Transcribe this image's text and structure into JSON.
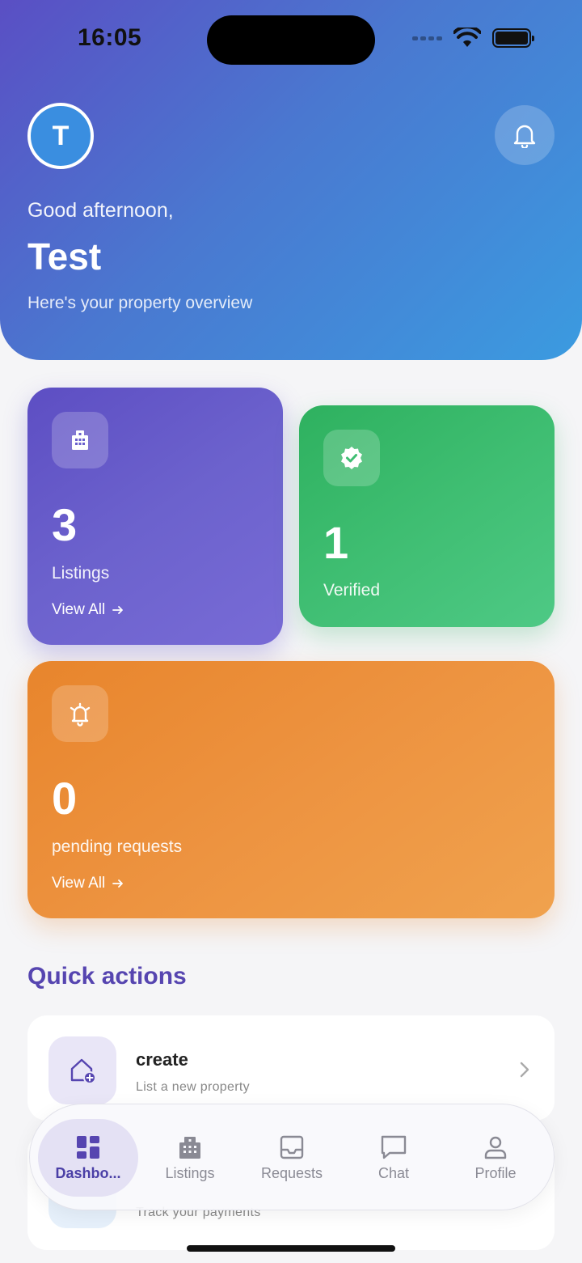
{
  "status_bar": {
    "time": "16:05"
  },
  "header": {
    "avatar_initial": "T",
    "greeting": "Good afternoon,",
    "user_name": "Test",
    "subtitle": "Here's your property overview"
  },
  "stats": {
    "listings": {
      "value": "3",
      "label": "Listings",
      "link": "View All",
      "icon": "building-icon"
    },
    "verified": {
      "value": "1",
      "label": "Verified",
      "icon": "verified-badge-icon"
    },
    "pending": {
      "value": "0",
      "label": "pending requests",
      "link": "View All",
      "icon": "alarm-bell-icon"
    }
  },
  "quick_actions": {
    "title": "Quick actions",
    "items": [
      {
        "title": "create",
        "subtitle": "List a new property",
        "icon": "home-add-icon"
      },
      {
        "title": "",
        "subtitle": "Track your payments",
        "icon": "payments-icon"
      }
    ]
  },
  "nav": {
    "items": [
      {
        "label": "Dashbo...",
        "icon": "dashboard-icon",
        "active": true
      },
      {
        "label": "Listings",
        "icon": "building-icon",
        "active": false
      },
      {
        "label": "Requests",
        "icon": "inbox-icon",
        "active": false
      },
      {
        "label": "Chat",
        "icon": "chat-icon",
        "active": false
      },
      {
        "label": "Profile",
        "icon": "person-icon",
        "active": false
      }
    ]
  },
  "colors": {
    "primary": "#5645b0",
    "listings_card": "#6a5fcc",
    "verified_card": "#3fbe72",
    "pending_card": "#ed9340"
  }
}
